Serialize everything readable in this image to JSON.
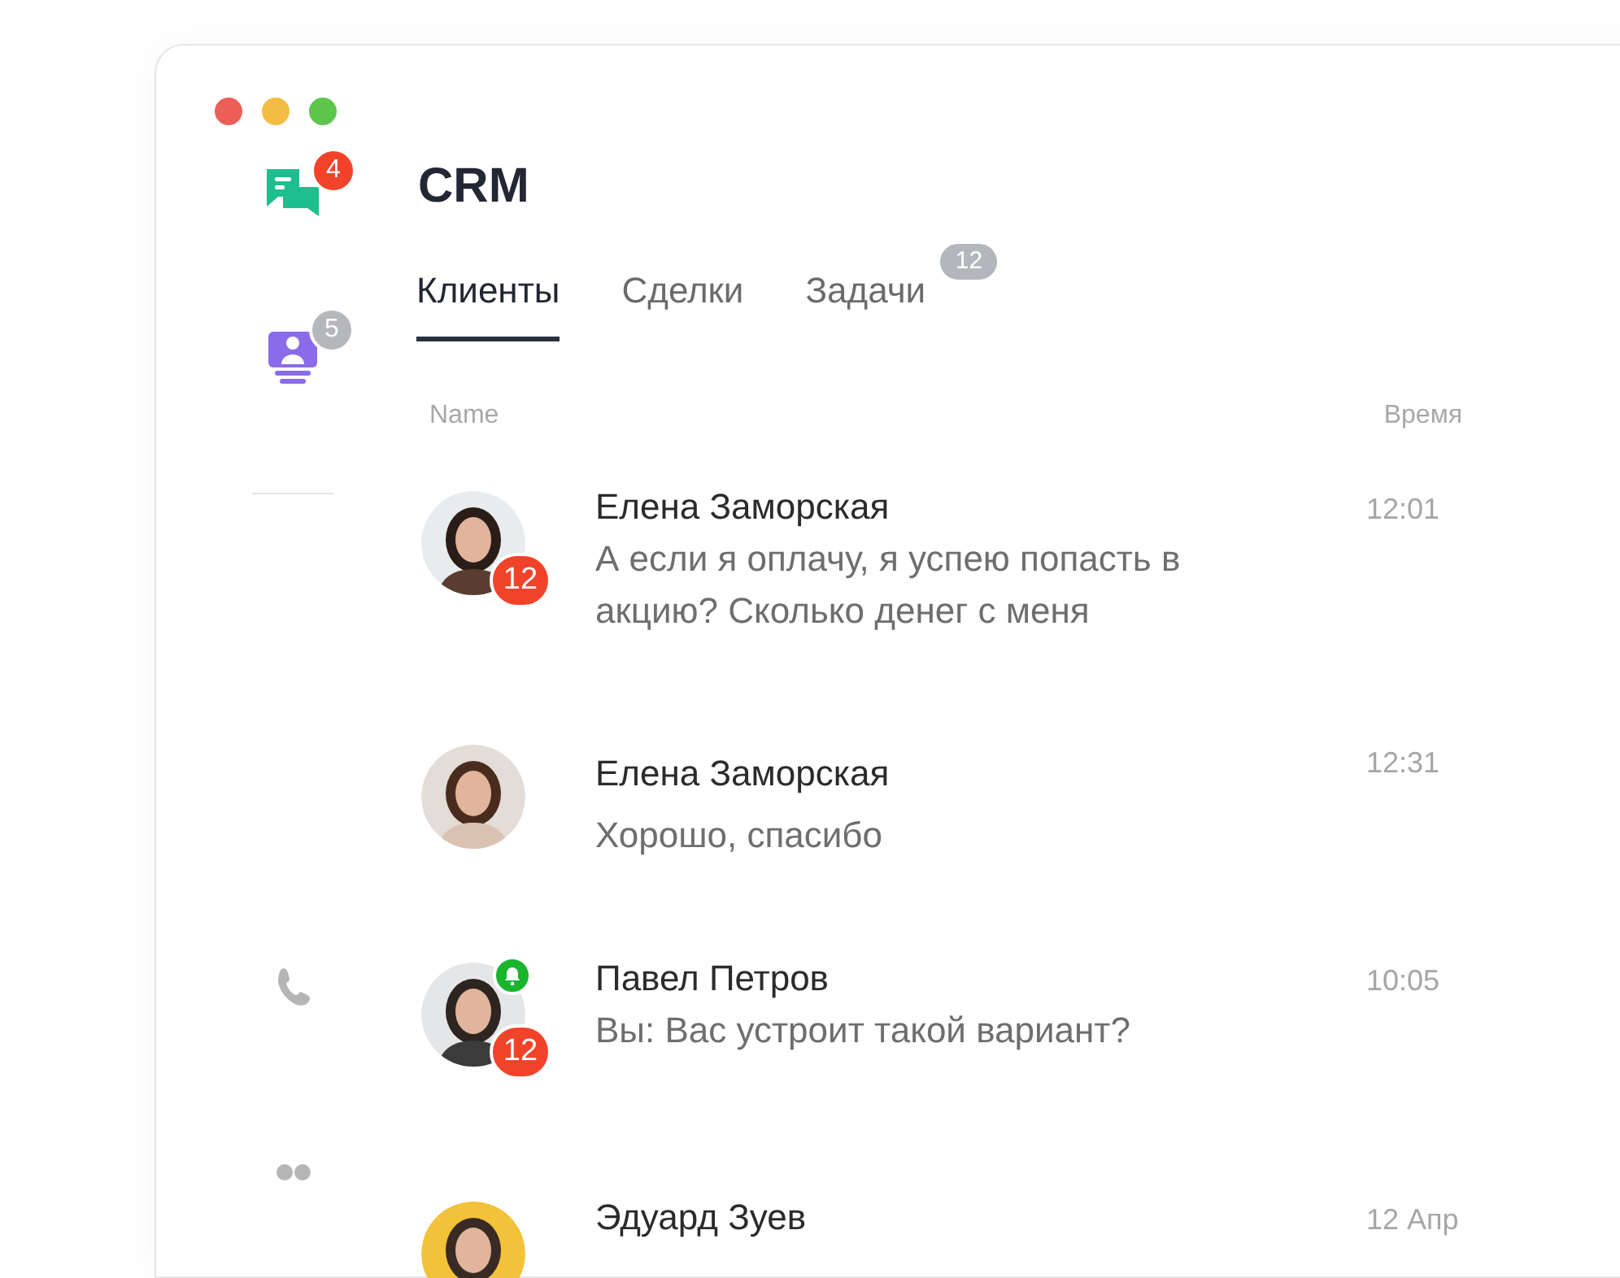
{
  "window": {
    "title": "CRM"
  },
  "sidebar": {
    "items": [
      {
        "kind": "chats",
        "badge": "4",
        "color": "#f0432a"
      },
      {
        "kind": "contacts",
        "badge": "5",
        "color": "#b5b7bb"
      },
      {
        "kind": "divider"
      },
      {
        "kind": "calls"
      },
      {
        "kind": "people"
      }
    ]
  },
  "tabs": [
    {
      "label": "Клиенты",
      "selected": true
    },
    {
      "label": "Сделки",
      "selected": false
    },
    {
      "label": "Задачи",
      "selected": false,
      "badge": "12"
    }
  ],
  "table": {
    "columns": [
      "Name",
      "Время"
    ],
    "rows": [
      {
        "name": "Елена Заморская",
        "message": "А если я оплачу, я успею попасть в акцию? Сколько денег с меня",
        "time": "12:01",
        "unread": "12",
        "notify": false
      },
      {
        "name": "Елена Заморская",
        "message": "Хорошо, спасибо",
        "time": "12:31",
        "notify": false
      },
      {
        "name": "Павел Петров",
        "message": "Вы: Вас устроит такой вариант?",
        "time": "10:05",
        "unread": "12",
        "notify": true
      },
      {
        "name": "Эдуард Зуев",
        "time": "12 Апр",
        "notify": false
      }
    ]
  }
}
